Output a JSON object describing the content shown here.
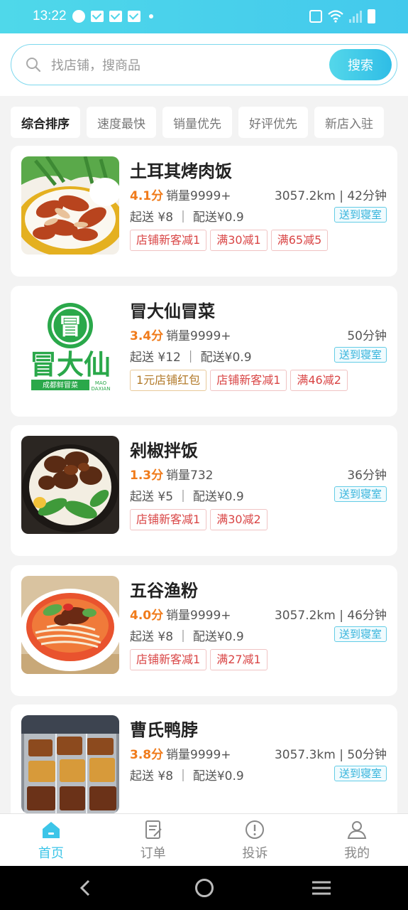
{
  "status_bar": {
    "time": "13:22"
  },
  "search": {
    "placeholder": "找店铺，搜商品",
    "button_label": "搜索"
  },
  "filters": [
    "综合排序",
    "速度最快",
    "销量优先",
    "好评优先",
    "新店入驻"
  ],
  "stores": [
    {
      "name": "土耳其烤肉饭",
      "rating": "4.1分",
      "sales": "销量9999+",
      "distance": "3057.2km | 42分钟",
      "delivery": "起送 ¥8 ｜ 配送¥0.9",
      "dorm_badge": "送到寝室",
      "tags": [
        "店铺新客减1",
        "满30减1",
        "满65减5"
      ]
    },
    {
      "name": "冒大仙冒菜",
      "rating": "3.4分",
      "sales": "销量9999+",
      "distance": "50分钟",
      "delivery": "起送 ¥12 ｜ 配送¥0.9",
      "dorm_badge": "送到寝室",
      "tags": [
        "1元店铺红包",
        "店铺新客减1",
        "满46减2"
      ],
      "logo": {
        "brand": "冒大仙",
        "sub": "成都鲜冒菜",
        "pinyin1": "MAO",
        "pinyin2": "DAXIAN",
        "seal": "冒"
      }
    },
    {
      "name": "剁椒拌饭",
      "rating": "1.3分",
      "sales": "销量732",
      "distance": "36分钟",
      "delivery": "起送 ¥5 ｜ 配送¥0.9",
      "dorm_badge": "送到寝室",
      "tags": [
        "店铺新客减1",
        "满30减2"
      ]
    },
    {
      "name": "五谷渔粉",
      "rating": "4.0分",
      "sales": "销量9999+",
      "distance": "3057.2km | 46分钟",
      "delivery": "起送 ¥8 ｜ 配送¥0.9",
      "dorm_badge": "送到寝室",
      "tags": [
        "店铺新客减1",
        "满27减1"
      ]
    },
    {
      "name": "曹氏鸭脖",
      "rating": "3.8分",
      "sales": "销量9999+",
      "distance": "3057.3km | 50分钟",
      "delivery": "起送 ¥8 ｜ 配送¥0.9",
      "dorm_badge": "送到寝室",
      "tags": []
    }
  ],
  "tabs": [
    {
      "label": "首页",
      "icon": "home-icon",
      "active": true
    },
    {
      "label": "订单",
      "icon": "order-icon",
      "active": false
    },
    {
      "label": "投诉",
      "icon": "complaint-icon",
      "active": false
    },
    {
      "label": "我的",
      "icon": "user-icon",
      "active": false
    }
  ],
  "colors": {
    "accent": "#3cc5e8",
    "rating": "#f07b1b",
    "tag_red": "#d94545",
    "logo_green": "#2aa84a"
  }
}
